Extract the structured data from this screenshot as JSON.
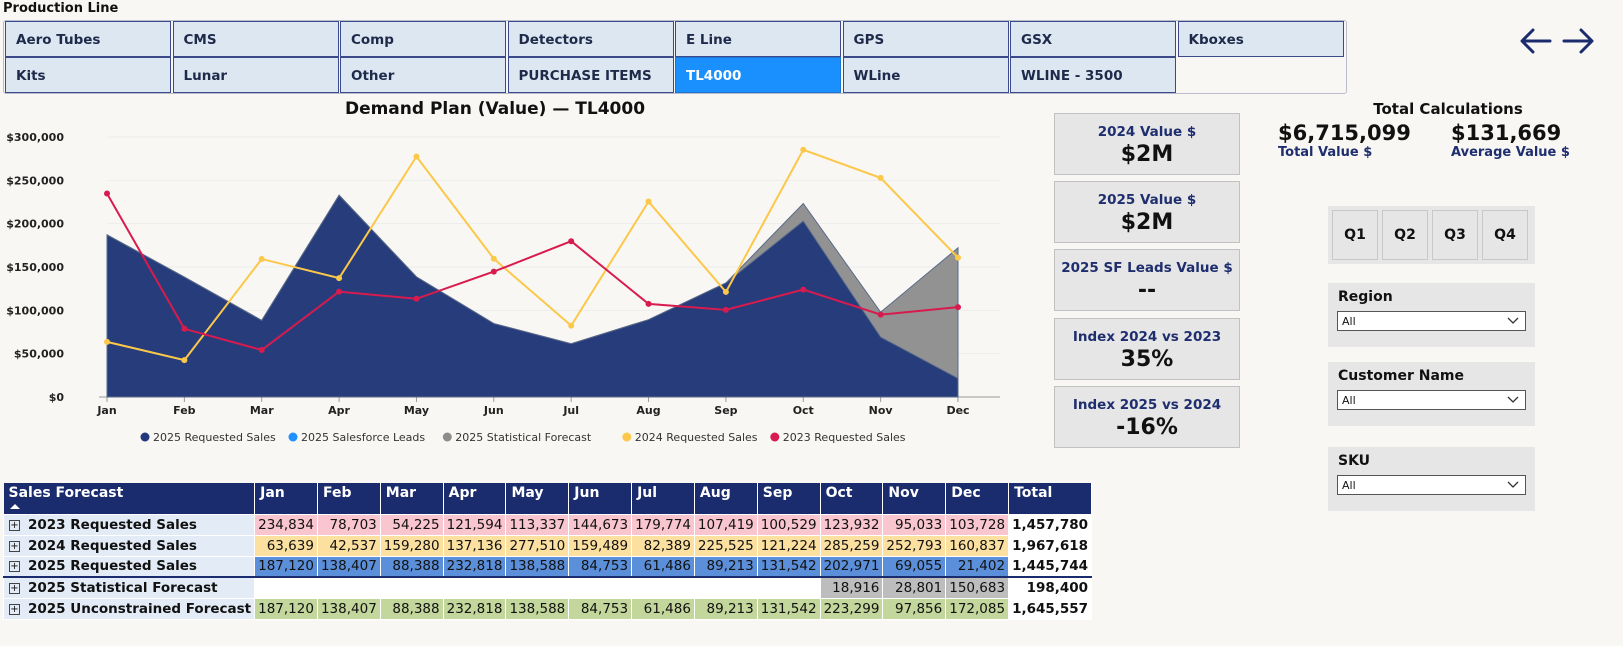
{
  "page": {
    "title": "Production Line"
  },
  "tabs": [
    {
      "label": "Aero Tubes"
    },
    {
      "label": "CMS"
    },
    {
      "label": "Comp"
    },
    {
      "label": "Detectors"
    },
    {
      "label": "E Line"
    },
    {
      "label": "GPS"
    },
    {
      "label": "GSX"
    },
    {
      "label": "Kboxes"
    },
    {
      "label": "Kits"
    },
    {
      "label": "Lunar"
    },
    {
      "label": "Other"
    },
    {
      "label": "PURCHASE ITEMS"
    },
    {
      "label": "TL4000",
      "active": true
    },
    {
      "label": "WLine"
    },
    {
      "label": "WLINE - 3500"
    }
  ],
  "nav": {
    "back_icon": "arrow-left-icon",
    "forward_icon": "arrow-right-icon"
  },
  "chart_data": {
    "type": "area",
    "title": "Demand Plan (Value) — TL4000",
    "categories": [
      "Jan",
      "Feb",
      "Mar",
      "Apr",
      "May",
      "Jun",
      "Jul",
      "Aug",
      "Sep",
      "Oct",
      "Nov",
      "Dec"
    ],
    "ylim": [
      0,
      300000
    ],
    "yticks": [
      {
        "value": 0,
        "label": "$0"
      },
      {
        "value": 50000,
        "label": "$50,000"
      },
      {
        "value": 100000,
        "label": "$100,000"
      },
      {
        "value": 150000,
        "label": "$150,000"
      },
      {
        "value": 200000,
        "label": "$200,000"
      },
      {
        "value": 250000,
        "label": "$250,000"
      },
      {
        "value": 300000,
        "label": "$300,000"
      }
    ],
    "legend_position": "bottom",
    "series": [
      {
        "name": "2025 Requested Sales",
        "kind": "area",
        "color": "#22387a",
        "values": [
          187120,
          138407,
          88388,
          232818,
          138588,
          84753,
          61486,
          89213,
          131542,
          202971,
          69055,
          21402
        ]
      },
      {
        "name": "2025 Salesforce Leads",
        "kind": "line",
        "color": "#1e90ff",
        "values": []
      },
      {
        "name": "2025 Statistical Forecast",
        "kind": "area",
        "color": "#8c8c8c",
        "values": [
          187120,
          138407,
          88388,
          232818,
          138588,
          84753,
          61486,
          89213,
          131542,
          223299,
          97856,
          172085
        ]
      },
      {
        "name": "2024 Requested Sales",
        "kind": "line",
        "color": "#fcc84a",
        "values": [
          63639,
          42537,
          159280,
          137136,
          277510,
          159489,
          82389,
          225525,
          121224,
          285259,
          252793,
          160837
        ]
      },
      {
        "name": "2023 Requested Sales",
        "kind": "line",
        "color": "#d81b4e",
        "values": [
          234834,
          78703,
          54225,
          121594,
          113337,
          144673,
          179774,
          107419,
          100529,
          123932,
          95033,
          103728
        ]
      }
    ]
  },
  "kpis": [
    {
      "label": "2024 Value $",
      "value": "$2M"
    },
    {
      "label": "2025 Value $",
      "value": "$2M"
    },
    {
      "label": "2025 SF Leads Value $",
      "value": "--"
    },
    {
      "label": "Index 2024 vs 2023",
      "value": "35%"
    },
    {
      "label": "Index 2025 vs 2024",
      "value": "-16%"
    }
  ],
  "total_calculations": {
    "title": "Total Calculations",
    "total_value": "$6,715,099",
    "total_label": "Total Value $",
    "average_value": "$131,669",
    "average_label": "Average Value $"
  },
  "quarters": [
    "Q1",
    "Q2",
    "Q3",
    "Q4"
  ],
  "slicers": [
    {
      "label": "Region",
      "selected": "All"
    },
    {
      "label": "Customer Name",
      "selected": "All"
    },
    {
      "label": "SKU",
      "selected": "All"
    }
  ],
  "sales_forecast": {
    "header": "Sales Forecast",
    "columns": [
      "Jan",
      "Feb",
      "Mar",
      "Apr",
      "May",
      "Jun",
      "Jul",
      "Aug",
      "Sep",
      "Oct",
      "Nov",
      "Dec",
      "Total"
    ],
    "rows": [
      {
        "label": "2023 Requested Sales",
        "values": [
          "234,834",
          "78,703",
          "54,225",
          "121,594",
          "113,337",
          "144,673",
          "179,774",
          "107,419",
          "100,529",
          "123,932",
          "95,033",
          "103,728"
        ],
        "total": "1,457,780"
      },
      {
        "label": "2024 Requested Sales",
        "values": [
          "63,639",
          "42,537",
          "159,280",
          "137,136",
          "277,510",
          "159,489",
          "82,389",
          "225,525",
          "121,224",
          "285,259",
          "252,793",
          "160,837"
        ],
        "total": "1,967,618"
      },
      {
        "label": "2025 Requested Sales",
        "values": [
          "187,120",
          "138,407",
          "88,388",
          "232,818",
          "138,588",
          "84,753",
          "61,486",
          "89,213",
          "131,542",
          "202,971",
          "69,055",
          "21,402"
        ],
        "total": "1,445,744"
      },
      {
        "label": "2025 Statistical Forecast",
        "values": [
          "",
          "",
          "",
          "",
          "",
          "",
          "",
          "",
          "",
          "18,916",
          "28,801",
          "150,683"
        ],
        "total": "198,400"
      },
      {
        "label": "2025 Unconstrained Forecast",
        "values": [
          "187,120",
          "138,407",
          "88,388",
          "232,818",
          "138,588",
          "84,753",
          "61,486",
          "89,213",
          "131,542",
          "223,299",
          "97,856",
          "172,085"
        ],
        "total": "1,645,557"
      }
    ]
  }
}
